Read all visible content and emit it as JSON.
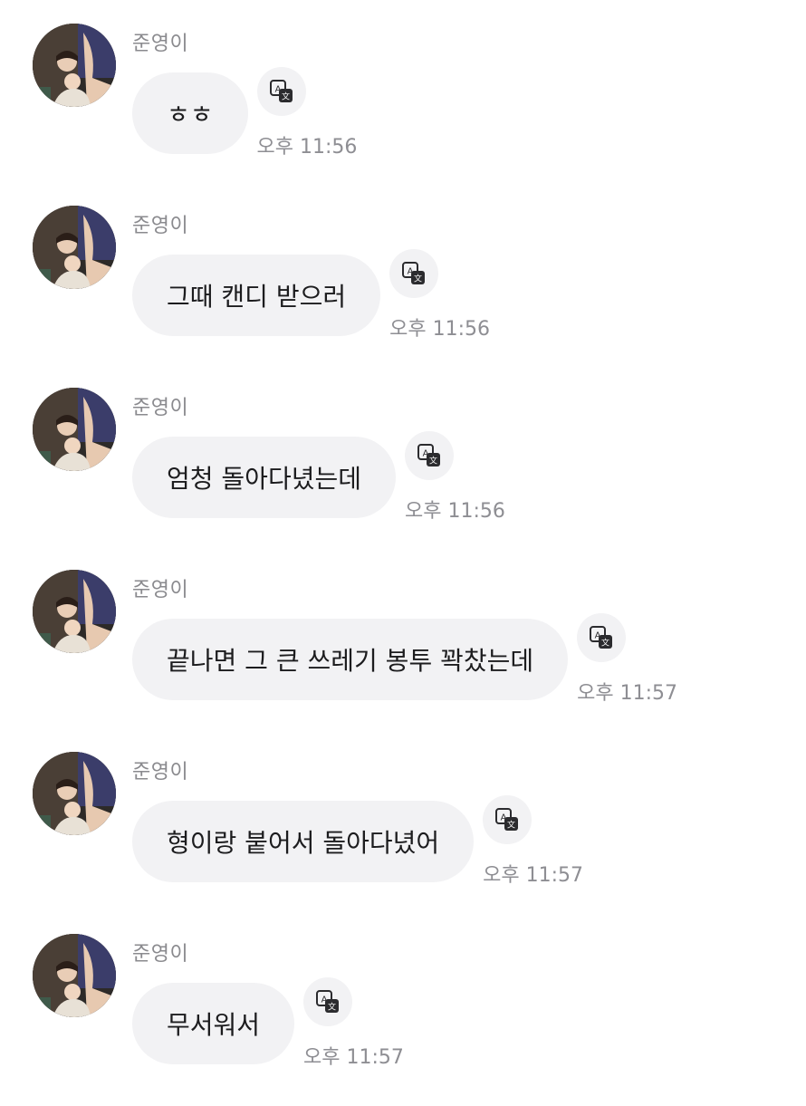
{
  "messages": [
    {
      "sender": "준영이",
      "text": "ㅎㅎ",
      "time": "오후 11:56"
    },
    {
      "sender": "준영이",
      "text": "그때 캔디 받으러",
      "time": "오후 11:56"
    },
    {
      "sender": "준영이",
      "text": "엄청 돌아다녔는데",
      "time": "오후 11:56"
    },
    {
      "sender": "준영이",
      "text": "끝나면 그 큰 쓰레기 봉투 꽉찼는데",
      "time": "오후 11:57"
    },
    {
      "sender": "준영이",
      "text": "형이랑 붙어서 돌아다녔어",
      "time": "오후 11:57"
    },
    {
      "sender": "준영이",
      "text": "무서워서",
      "time": "오후 11:57"
    }
  ],
  "icons": {
    "avatar": "profile-photo",
    "translate": "translate-icon"
  },
  "colors": {
    "bubble": "#f2f2f4",
    "text": "#1c1c1e",
    "meta": "#8e8e93"
  }
}
